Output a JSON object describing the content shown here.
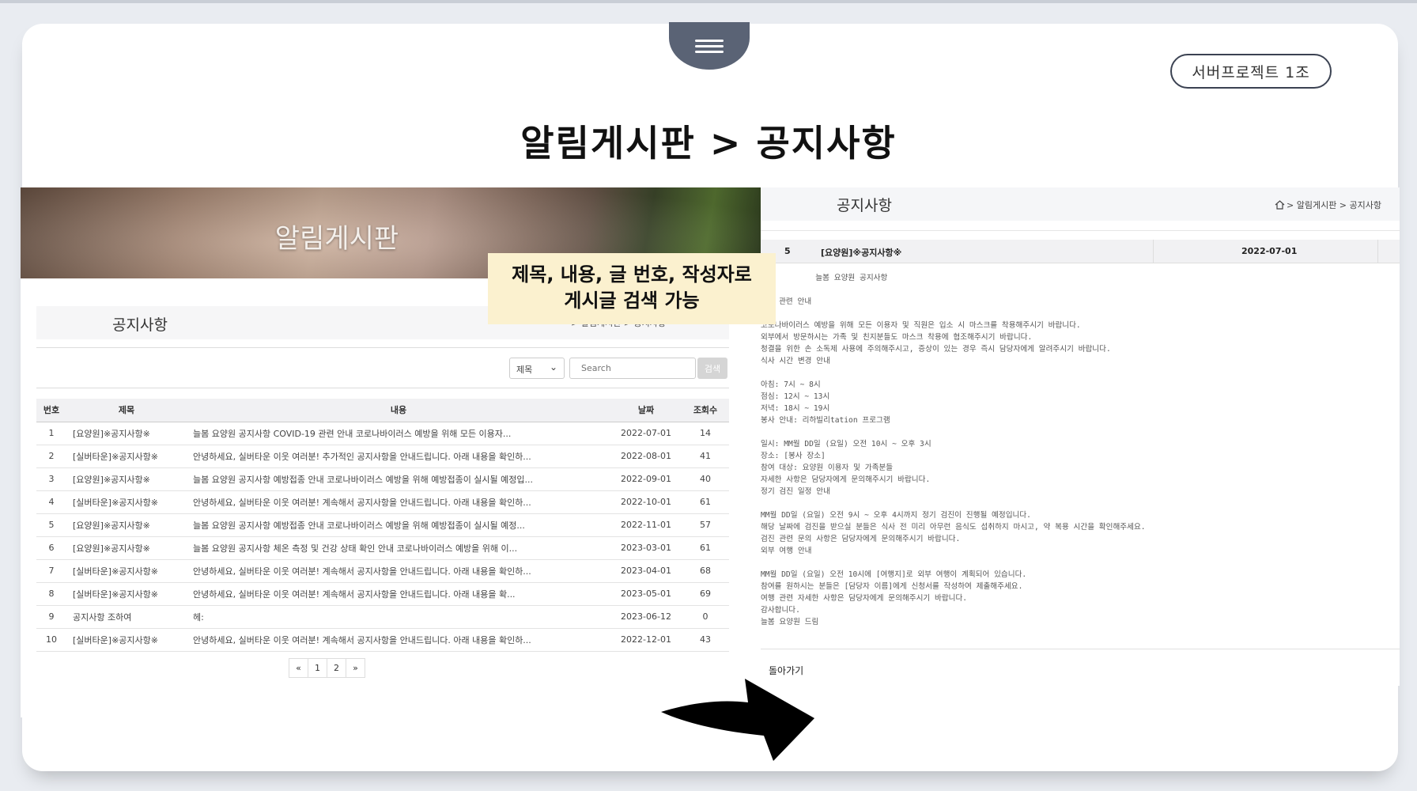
{
  "slide": {
    "team_badge": "서버프로젝트 1조",
    "title": "알림게시판 > 공지사항",
    "callout_line1": "제목, 내용, 글 번호, 작성자로",
    "callout_line2": "게시글 검색 가능"
  },
  "list_page": {
    "hero_title": "알림게시판",
    "section_title": "공지사항",
    "breadcrumb": "> 알림게시판 > 공지사항",
    "search": {
      "select_value": "제목",
      "placeholder": "Search",
      "button_label": "검색"
    },
    "columns": [
      "번호",
      "제목",
      "내용",
      "날짜",
      "조회수"
    ],
    "rows": [
      {
        "no": "1",
        "title": "[요양원]※공지사항※",
        "content": "늘봄 요양원 공지사항 COVID-19 관련 안내 코로나바이러스 예방을 위해 모든 이용자...",
        "date": "2022-07-01",
        "views": "14"
      },
      {
        "no": "2",
        "title": "[실버타운]※공지사항※",
        "content": "안녕하세요, 실버타운 이웃 여러분! 추가적인 공지사항을 안내드립니다. 아래 내용을 확인하...",
        "date": "2022-08-01",
        "views": "41"
      },
      {
        "no": "3",
        "title": "[요양원]※공지사항※",
        "content": "늘봄 요양원 공지사항 예방접종 안내 코로나바이러스 예방을 위해 예방접종이 실시될 예정입...",
        "date": "2022-09-01",
        "views": "40"
      },
      {
        "no": "4",
        "title": "[실버타운]※공지사항※",
        "content": "안녕하세요, 실버타운 이웃 여러분! 계속해서 공지사항을 안내드립니다. 아래 내용을 확인하...",
        "date": "2022-10-01",
        "views": "61"
      },
      {
        "no": "5",
        "title": "[요양원]※공지사항※",
        "content": "늘봄 요양원 공지사항 예방접종 안내 코로나바이러스 예방을 위해 예방접종이 실시될 예정...",
        "date": "2022-11-01",
        "views": "57"
      },
      {
        "no": "6",
        "title": "[요양원]※공지사항※",
        "content": "늘봄 요양원 공지사항 체온 측정 및 건강 상태 확인 안내 코로나바이러스 예방을 위해 이...",
        "date": "2023-03-01",
        "views": "61"
      },
      {
        "no": "7",
        "title": "[실버타운]※공지사항※",
        "content": "안녕하세요, 실버타운 이웃 여러분! 계속해서 공지사항을 안내드립니다. 아래 내용을 확인하...",
        "date": "2023-04-01",
        "views": "68"
      },
      {
        "no": "8",
        "title": "[실버타운]※공지사항※",
        "content": "안녕하세요, 실버타운 이웃 여러분! 계속해서 공지사항을 안내드립니다. 아래 내용을 확...",
        "date": "2023-05-01",
        "views": "69"
      },
      {
        "no": "9",
        "title": "공지사항 조하여",
        "content": "헤:",
        "date": "2023-06-12",
        "views": "0"
      },
      {
        "no": "10",
        "title": "[실버타운]※공지사항※",
        "content": "안녕하세요, 실버타운 이웃 여러분! 계속해서 공지사항을 안내드립니다. 아래 내용을 확인하...",
        "date": "2022-12-01",
        "views": "43"
      }
    ],
    "pagination": [
      "«",
      "1",
      "2",
      "»"
    ]
  },
  "detail_page": {
    "section_title": "공지사항",
    "breadcrumb": "> 알림게시판 > 공지사항",
    "post_no": "5",
    "post_title": "[요양원]※공지사항※",
    "post_date": "2022-07-01",
    "body_lines": [
      "            늘봄 요양원 공지사항",
      "",
      "-19 관련 안내",
      "",
      "코로나바이러스 예방을 위해 모든 이용자 및 직원은 입소 시 마스크를 착용해주시기 바랍니다.",
      "외부에서 방문하시는 가족 및 친지분들도 마스크 착용에 협조해주시기 바랍니다.",
      "청결을 위한 손 소독제 사용에 주의해주시고, 증상이 있는 경우 즉시 담당자에게 알려주시기 바랍니다.",
      "식사 시간 변경 안내",
      "",
      "아침: 7시 ~ 8시",
      "점심: 12시 ~ 13시",
      "저녁: 18시 ~ 19시",
      "봉사 안내: 리하빌리tation 프로그램",
      "",
      "일시: MM월 DD일 (요일) 오전 10시 ~ 오후 3시",
      "장소: [봉사 장소]",
      "참여 대상: 요양원 이용자 및 가족분들",
      "자세한 사항은 담당자에게 문의해주시기 바랍니다.",
      "정기 검진 일정 안내",
      "",
      "MM월 DD일 (요일) 오전 9시 ~ 오후 4시까지 정기 검진이 진행될 예정입니다.",
      "해당 날짜에 검진을 받으실 분들은 식사 전 미리 아무런 음식도 섭취하지 마시고, 약 복용 시간을 확인해주세요.",
      "검진 관련 문의 사항은 담당자에게 문의해주시기 바랍니다.",
      "외부 여행 안내",
      "",
      "MM월 DD일 (요일) 오전 10시에 [여행지]로 외부 여행이 계획되어 있습니다.",
      "참여를 원하시는 분들은 [담당자 이름]에게 신청서를 작성하여 제출해주세요.",
      "여행 관련 자세한 사항은 담당자에게 문의해주시기 바랍니다.",
      "감사합니다.",
      "늘봄 요양원 드림"
    ],
    "back_label": "돌아가기"
  }
}
